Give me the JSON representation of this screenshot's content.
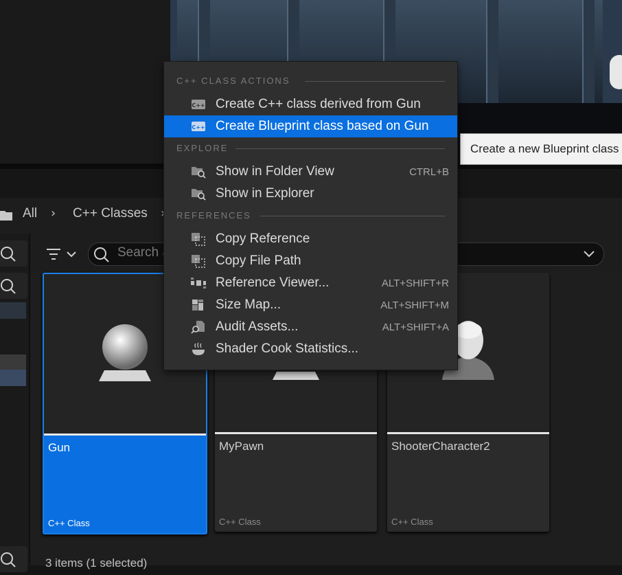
{
  "breadcrumb": {
    "root": "All",
    "folder": "C++ Classes"
  },
  "toolbar": {
    "search_placeholder": "Search a"
  },
  "tiles": [
    {
      "name": "Gun",
      "kind": "C++ Class",
      "selected": true
    },
    {
      "name": "MyPawn",
      "kind": "C++ Class",
      "selected": false
    },
    {
      "name": "ShooterCharacter2",
      "kind": "C++ Class",
      "selected": false
    }
  ],
  "status": "3 items (1 selected)",
  "tooltip": "Create a new Blueprint class",
  "menu": {
    "sections": [
      {
        "title": "C++ CLASS ACTIONS"
      },
      {
        "title": "EXPLORE"
      },
      {
        "title": "REFERENCES"
      }
    ],
    "items": [
      {
        "label": "Create C++ class derived from Gun",
        "shortcut": "",
        "icon": "cpp-icon"
      },
      {
        "label": "Create Blueprint class based on Gun",
        "shortcut": "",
        "icon": "cpp-icon",
        "highlighted": true
      },
      {
        "label": "Show in Folder View",
        "shortcut": "CTRL+B",
        "icon": "folder-search-icon"
      },
      {
        "label": "Show in Explorer",
        "shortcut": "",
        "icon": "folder-search-icon"
      },
      {
        "label": "Copy Reference",
        "shortcut": "",
        "icon": "copy-icon"
      },
      {
        "label": "Copy File Path",
        "shortcut": "",
        "icon": "copy-icon"
      },
      {
        "label": "Reference Viewer...",
        "shortcut": "ALT+SHIFT+R",
        "icon": "reference-viewer-icon"
      },
      {
        "label": "Size Map...",
        "shortcut": "ALT+SHIFT+M",
        "icon": "size-map-icon"
      },
      {
        "label": "Audit Assets...",
        "shortcut": "ALT+SHIFT+A",
        "icon": "audit-icon"
      },
      {
        "label": "Shader Cook Statistics...",
        "shortcut": "",
        "icon": "shader-icon"
      }
    ]
  },
  "colors": {
    "accent": "#0a6fe0",
    "menu_bg": "#2f2f2f",
    "panel_bg": "#1e1e1e"
  }
}
